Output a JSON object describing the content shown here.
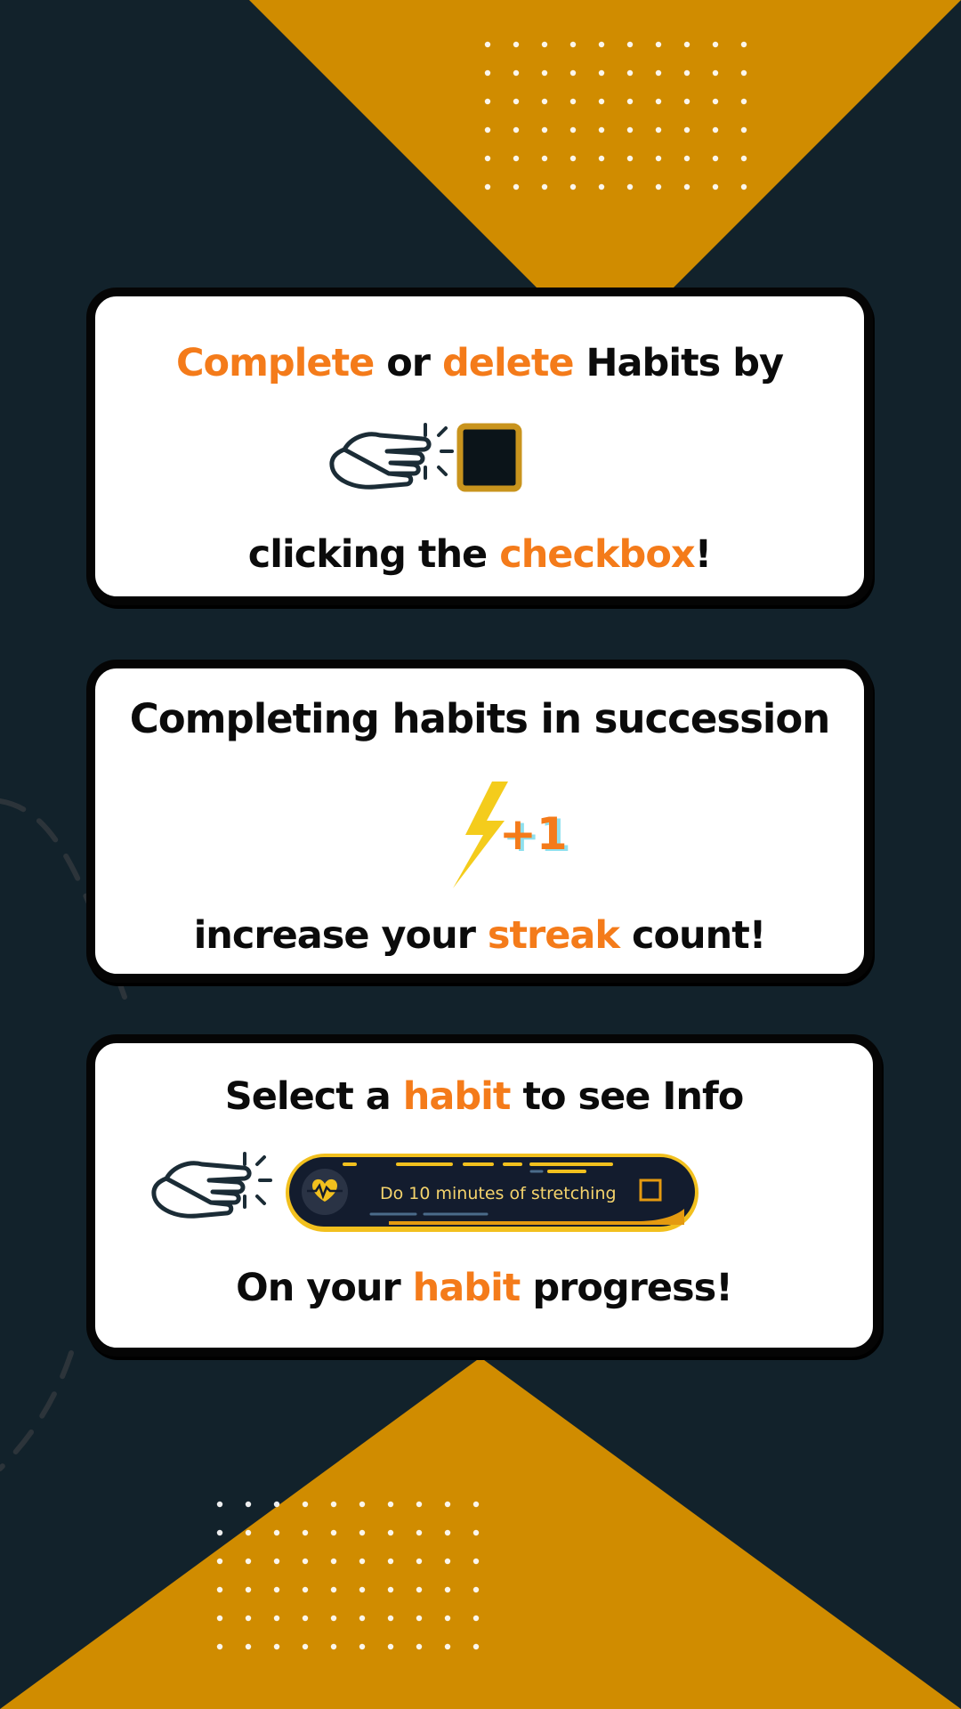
{
  "colors": {
    "background": "#12222b",
    "triangle": "#d08c00",
    "card": "#ffffff",
    "accent": "#f47b1a",
    "text": "#0b0b0b",
    "bolt": "#f4cc1c",
    "checkbox_border": "#c9941d",
    "checkbox_fill": "#0b1419"
  },
  "card1": {
    "line1": {
      "w1": "Complete",
      "w2": " or ",
      "w3": "delete",
      "w4": " Habits by"
    },
    "line2": {
      "w1": "clicking the ",
      "w2": "checkbox",
      "w3": "!"
    },
    "icons": [
      "pointing-hand-icon",
      "checkbox-icon"
    ]
  },
  "card2": {
    "line1": "Completing habits in succession",
    "badge": "+1",
    "line2": {
      "w1": "increase your ",
      "w2": "streak",
      "w3": " count!"
    },
    "icons": [
      "lightning-bolt-icon"
    ]
  },
  "card3": {
    "line1": {
      "w1": "Select a ",
      "w2": "habit",
      "w3": " to see Info"
    },
    "habit_label": "Do 10 minutes of stretching",
    "line2": {
      "w1": "On your ",
      "w2": "habit",
      "w3": " progress!"
    },
    "icons": [
      "pointing-hand-icon",
      "heartbeat-dumbbell-icon",
      "checkbox-icon"
    ]
  }
}
